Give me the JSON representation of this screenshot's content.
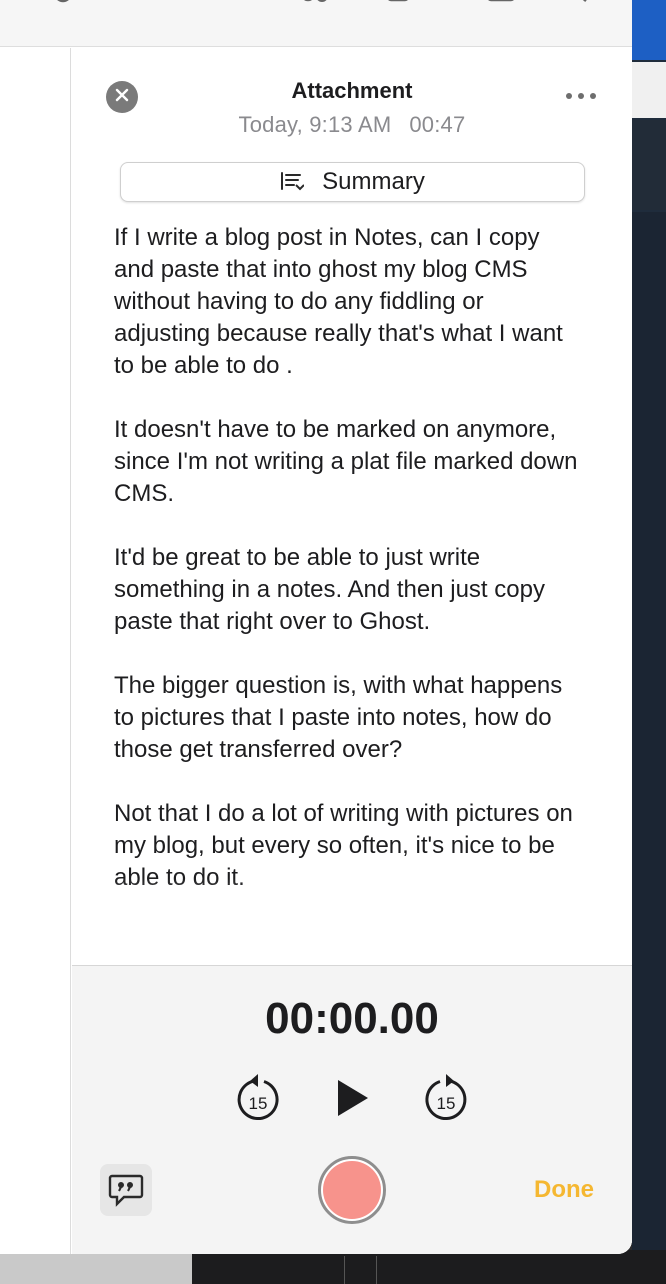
{
  "attachment": {
    "title": "Attachment",
    "date": "Today, 9:13 AM",
    "duration": "00:47"
  },
  "summary_button": {
    "label": "Summary"
  },
  "transcript": {
    "paragraphs": [
      "If I write a blog post in Notes, can I copy and paste that into ghost my blog CMS without having to do any fiddling or adjusting because really that's what I want to be able to do .",
      "It doesn't have to be marked on anymore, since I'm not writing a plat file marked down CMS.",
      "It'd be great to be able to just write something in a notes. And then just copy paste that right over to Ghost.",
      "The bigger question is, with what happens to pictures that I paste into notes, how do those get transferred over?",
      "Not that I do a lot of writing with pictures on my blog, but every so often, it's nice to be able to do it."
    ]
  },
  "player": {
    "time": "00:00.00",
    "skip_back_seconds": "15",
    "skip_forward_seconds": "15",
    "done_label": "Done"
  },
  "colors": {
    "accent_done": "#f5b731",
    "record_fill": "#f7938c",
    "secondary_text": "#8a8a8e"
  },
  "icons": {
    "close": "close-icon",
    "more": "ellipsis-icon",
    "summary": "summary-list-icon",
    "skip_back": "skip-back-15-icon",
    "play": "play-icon",
    "skip_forward": "skip-forward-15-icon",
    "transcript": "transcript-quote-bubble-icon",
    "record": "record-icon"
  }
}
